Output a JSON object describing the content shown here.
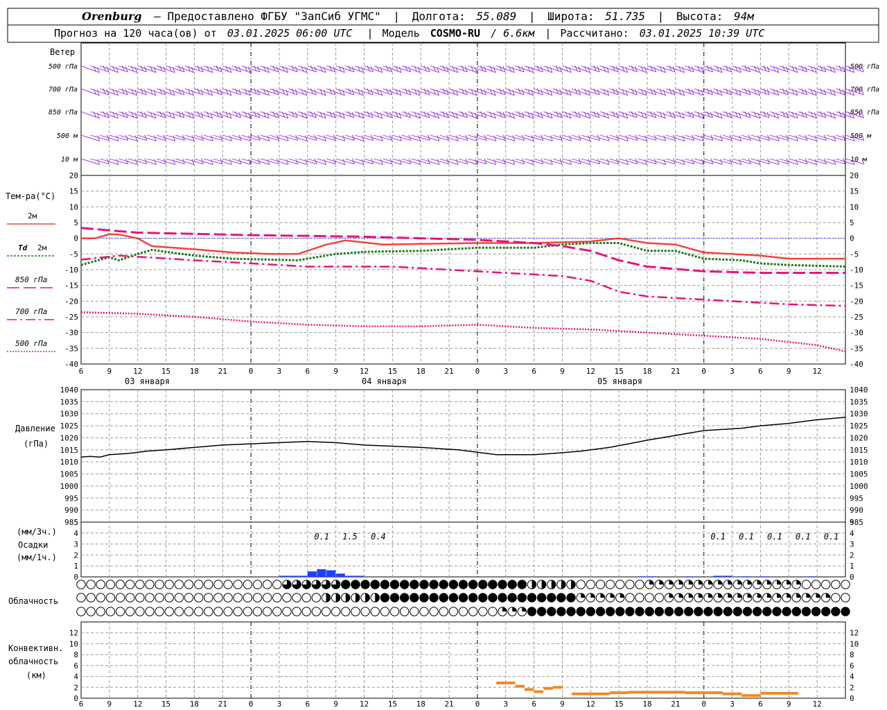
{
  "header": {
    "city": "Orenburg",
    "provider": "— Предоставлено ФГБУ \"ЗапСиб УГМС\"",
    "lon_label": "Долгота:",
    "lon_value": "55.089",
    "lat_label": "Широта:",
    "lat_value": "51.735",
    "alt_label": "Высота:",
    "alt_value": "94м",
    "forecast_label": "Прогноз на 120 часа(ов) от",
    "forecast_time": "03.01.2025 06:00 UTC",
    "model_label": "Модель",
    "model_name": "COSMO-RU",
    "model_res": "/ 6.6км",
    "calc_label": "Рассчитано:",
    "calc_time": "03.01.2025 10:39 UTC"
  },
  "wind_panel": {
    "title": "Ветер",
    "levels": [
      "500 гПа",
      "700 гПа",
      "850 гПа",
      "500 м",
      "10  м"
    ],
    "color": "#8a2be2"
  },
  "temp_panel": {
    "title": "Тем-ра(°C)",
    "legend": [
      {
        "key": "2m",
        "label": "2м",
        "color": "#f0453a"
      },
      {
        "key": "td",
        "label_a": "Td",
        "label_b": "2м",
        "color": "#1a7a1a"
      },
      {
        "key": "t850",
        "label": "850 гПа",
        "color": "#e8137a"
      },
      {
        "key": "t700",
        "label": "700 гПа",
        "color": "#e8137a"
      },
      {
        "key": "t500",
        "label": "500 гПа",
        "color": "#e8137a"
      }
    ]
  },
  "pressure_panel": {
    "label1": "Давление",
    "label2": "(гПа)"
  },
  "precip_panel": {
    "label1": "(мм/3ч.)",
    "label2": "Осадки",
    "label3": "(мм/1ч.)",
    "amounts": [
      {
        "h": 27,
        "text": "0.1"
      },
      {
        "h": 30,
        "text": "1.5"
      },
      {
        "h": 33,
        "text": "0.4"
      },
      {
        "h": 69,
        "text": "0.1"
      },
      {
        "h": 72,
        "text": "0.1"
      },
      {
        "h": 75,
        "text": "0.1"
      },
      {
        "h": 78,
        "text": "0.1"
      },
      {
        "h": 81,
        "text": "0.1"
      }
    ]
  },
  "cloud_panel": {
    "label": "Облачность"
  },
  "convective_panel": {
    "label1": "Конвективн.",
    "label2": "облачность",
    "label3": "(км)"
  },
  "days": [
    "03 января",
    "04 января",
    "05 января"
  ],
  "hour_labels": [
    "6",
    "9",
    "12",
    "15",
    "18",
    "21",
    "0",
    "3",
    "6",
    "9",
    "12",
    "15",
    "18",
    "21",
    "0",
    "3",
    "6",
    "9",
    "12",
    "15",
    "18",
    "21",
    "0",
    "3",
    "6",
    "9",
    "12"
  ],
  "chart_data": [
    {
      "type": "line",
      "title": "Тем-ра(°C)",
      "x_hours_since_start": [
        0,
        3,
        6,
        9,
        12,
        15,
        18,
        21,
        24,
        27,
        30,
        33,
        36,
        39,
        42,
        45,
        48,
        51,
        54,
        57,
        60,
        63,
        66,
        69,
        72,
        75,
        78
      ],
      "ylim": [
        -40,
        20
      ],
      "yticks": [
        20,
        15,
        10,
        5,
        0,
        -5,
        -10,
        -15,
        -20,
        -25,
        -30,
        -35,
        -40
      ],
      "series": [
        {
          "name": "2м",
          "style": "solid",
          "color": "#f0453a",
          "points": [
            [
              0,
              0
            ],
            [
              1.5,
              0
            ],
            [
              3,
              1.3
            ],
            [
              4,
              1.2
            ],
            [
              6,
              0
            ],
            [
              7.5,
              -2.5
            ],
            [
              12,
              -3.5
            ],
            [
              16,
              -4.5
            ],
            [
              20,
              -5
            ],
            [
              23,
              -5
            ],
            [
              26,
              -2
            ],
            [
              28,
              -0.7
            ],
            [
              30,
              -1.3
            ],
            [
              32,
              -2
            ],
            [
              36,
              -1.8
            ],
            [
              42,
              -1.5
            ],
            [
              48,
              -1.5
            ],
            [
              54,
              -1
            ],
            [
              57,
              0
            ],
            [
              60,
              -1.5
            ],
            [
              63,
              -2
            ],
            [
              66,
              -4.5
            ],
            [
              72,
              -5.5
            ],
            [
              75,
              -6.5
            ],
            [
              81,
              -6.5
            ]
          ]
        },
        {
          "name": "Td 2м",
          "style": "dotted",
          "color": "#1a7a1a",
          "points": [
            [
              0,
              -8.5
            ],
            [
              3,
              -6
            ],
            [
              4,
              -7
            ],
            [
              6,
              -5
            ],
            [
              7.5,
              -3.7
            ],
            [
              12,
              -5.5
            ],
            [
              16,
              -6.5
            ],
            [
              23,
              -7
            ],
            [
              27,
              -5
            ],
            [
              30,
              -4.3
            ],
            [
              36,
              -4
            ],
            [
              42,
              -3
            ],
            [
              48,
              -3
            ],
            [
              51,
              -2
            ],
            [
              54,
              -1.5
            ],
            [
              57,
              -1.5
            ],
            [
              60,
              -4
            ],
            [
              63,
              -4
            ],
            [
              66,
              -6.5
            ],
            [
              70,
              -7
            ],
            [
              72,
              -8
            ],
            [
              75,
              -8.5
            ],
            [
              81,
              -9
            ]
          ]
        },
        {
          "name": "850 гПа",
          "style": "dash",
          "color": "#e8137a",
          "points": [
            [
              0,
              3.3
            ],
            [
              3,
              2.5
            ],
            [
              6,
              1.8
            ],
            [
              18,
              1
            ],
            [
              30,
              0.5
            ],
            [
              42,
              -0.5
            ],
            [
              48,
              -1.5
            ],
            [
              51,
              -2.5
            ],
            [
              54,
              -4
            ],
            [
              57,
              -7
            ],
            [
              60,
              -9
            ],
            [
              66,
              -10.5
            ],
            [
              72,
              -11
            ],
            [
              78,
              -11
            ],
            [
              81,
              -11
            ]
          ]
        },
        {
          "name": "700 гПа",
          "style": "dashdot",
          "color": "#e8137a",
          "points": [
            [
              0,
              -6.8
            ],
            [
              4,
              -5.5
            ],
            [
              12,
              -7
            ],
            [
              18,
              -8
            ],
            [
              24,
              -9
            ],
            [
              33,
              -9
            ],
            [
              42,
              -10.5
            ],
            [
              48,
              -11.5
            ],
            [
              51,
              -12
            ],
            [
              54,
              -13.5
            ],
            [
              57,
              -17
            ],
            [
              60,
              -18.5
            ],
            [
              66,
              -19.5
            ],
            [
              72,
              -20.5
            ],
            [
              75,
              -21
            ],
            [
              81,
              -21.5
            ]
          ]
        },
        {
          "name": "500 гПа",
          "style": "finedot",
          "color": "#e8137a",
          "points": [
            [
              0,
              -23.5
            ],
            [
              6,
              -24
            ],
            [
              12,
              -25
            ],
            [
              18,
              -26.5
            ],
            [
              24,
              -27.5
            ],
            [
              30,
              -28
            ],
            [
              36,
              -28
            ],
            [
              42,
              -27.5
            ],
            [
              48,
              -28.5
            ],
            [
              54,
              -29
            ],
            [
              60,
              -30
            ],
            [
              66,
              -31
            ],
            [
              72,
              -32
            ],
            [
              78,
              -34
            ],
            [
              81,
              -36
            ]
          ]
        }
      ]
    },
    {
      "type": "line",
      "title": "Давление (гПа)",
      "ylim": [
        985,
        1040
      ],
      "yticks": [
        1040,
        1035,
        1030,
        1025,
        1020,
        1015,
        1010,
        1005,
        1000,
        995,
        990,
        985
      ],
      "series": [
        {
          "name": "Давление",
          "color": "#000000",
          "points": [
            [
              0,
              1012
            ],
            [
              1,
              1012.3
            ],
            [
              2,
              1012
            ],
            [
              3,
              1013
            ],
            [
              5,
              1013.5
            ],
            [
              7,
              1014.5
            ],
            [
              9,
              1015
            ],
            [
              12,
              1016
            ],
            [
              15,
              1017
            ],
            [
              18,
              1017.5
            ],
            [
              21,
              1018
            ],
            [
              24,
              1018.5
            ],
            [
              27,
              1018
            ],
            [
              30,
              1017
            ],
            [
              36,
              1016
            ],
            [
              40,
              1015
            ],
            [
              42,
              1014
            ],
            [
              44,
              1013
            ],
            [
              48,
              1013
            ],
            [
              50,
              1013.5
            ],
            [
              53,
              1014.5
            ],
            [
              56,
              1016
            ],
            [
              58,
              1017.5
            ],
            [
              60,
              1019
            ],
            [
              63,
              1021
            ],
            [
              66,
              1023
            ],
            [
              70,
              1024
            ],
            [
              72,
              1025
            ],
            [
              75,
              1026
            ],
            [
              78,
              1027.5
            ],
            [
              81,
              1028.5
            ]
          ]
        }
      ]
    },
    {
      "type": "bar",
      "title": "Осадки (мм/1ч.)",
      "ylim": [
        0,
        5
      ],
      "yticks": [
        5,
        4,
        3,
        2,
        1,
        0
      ],
      "bars": [
        [
          21,
          0.1
        ],
        [
          22,
          0.1
        ],
        [
          23,
          0.1
        ],
        [
          24,
          0.5
        ],
        [
          25,
          0.7
        ],
        [
          26,
          0.6
        ],
        [
          27,
          0.3
        ],
        [
          28,
          0.1
        ],
        [
          29,
          0.1
        ],
        [
          59,
          0.05
        ],
        [
          60,
          0.05
        ],
        [
          64,
          0.05
        ],
        [
          67,
          0.1
        ],
        [
          68,
          0.1
        ],
        [
          70,
          0.05
        ],
        [
          72,
          0.05
        ],
        [
          77,
          0.05
        ]
      ]
    },
    {
      "type": "line",
      "title": "Конвективн. облачность (км)",
      "ylim": [
        0,
        14
      ],
      "yticks": [
        12,
        10,
        8,
        6,
        4,
        2,
        0
      ],
      "segments": [
        [
          44,
          46,
          2.8
        ],
        [
          46,
          47,
          2.2
        ],
        [
          47,
          48,
          1.6
        ],
        [
          48,
          49,
          1.2
        ],
        [
          49,
          50,
          1.8
        ],
        [
          50,
          51,
          2.0
        ],
        [
          52,
          54,
          0.8
        ],
        [
          54,
          56,
          0.8
        ],
        [
          56,
          58,
          1.0
        ],
        [
          58,
          64,
          1.1
        ],
        [
          64,
          68,
          1.0
        ],
        [
          68,
          70,
          0.8
        ],
        [
          70,
          72,
          0.5
        ],
        [
          72,
          76,
          0.9
        ]
      ]
    }
  ]
}
